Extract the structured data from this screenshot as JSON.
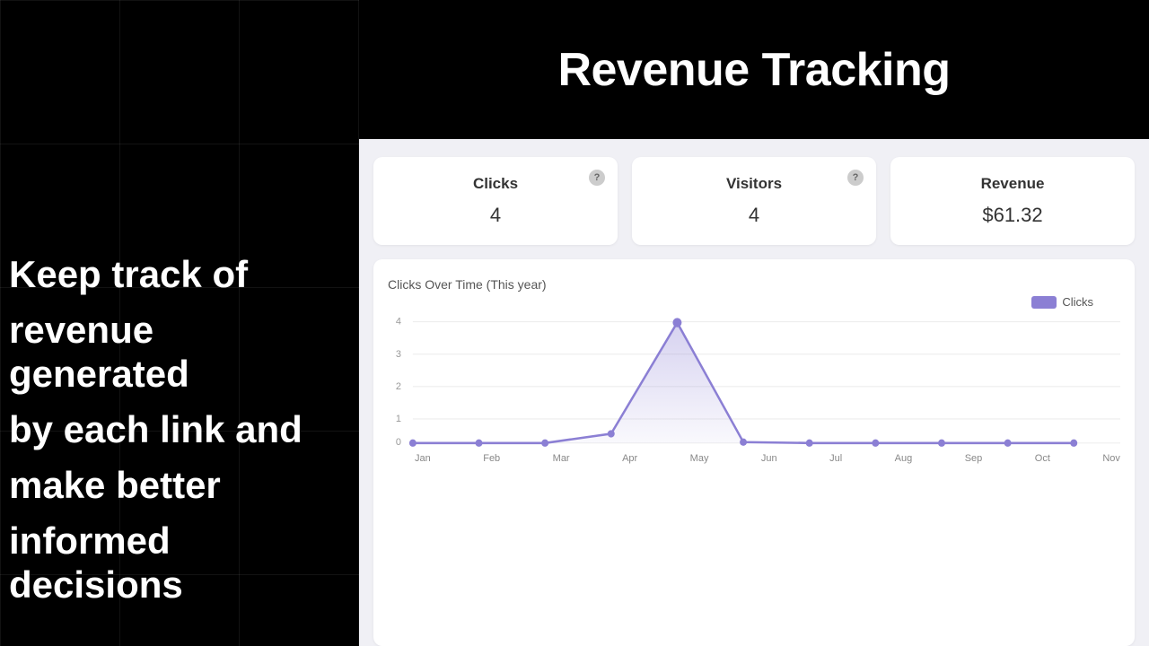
{
  "left": {
    "lines": [
      "Keep track of",
      "revenue generated",
      "by each link and",
      "make better",
      "informed decisions"
    ]
  },
  "header": {
    "title": "Revenue Tracking"
  },
  "stats": [
    {
      "id": "clicks",
      "label": "Clicks",
      "value": "4"
    },
    {
      "id": "visitors",
      "label": "Visitors",
      "value": "4"
    },
    {
      "id": "revenue",
      "label": "Revenue",
      "value": "$61.32"
    }
  ],
  "chart": {
    "title": "Clicks Over Time (This year)",
    "legend_label": "Clicks",
    "x_labels": [
      "Jan",
      "Feb",
      "Mar",
      "Apr",
      "May",
      "Jun",
      "Jul",
      "Aug",
      "Sep",
      "Oct",
      "Nov"
    ],
    "y_max": 4,
    "data_points": [
      0,
      0,
      0,
      0.3,
      4,
      0.1,
      0,
      0,
      0,
      0,
      0
    ]
  }
}
